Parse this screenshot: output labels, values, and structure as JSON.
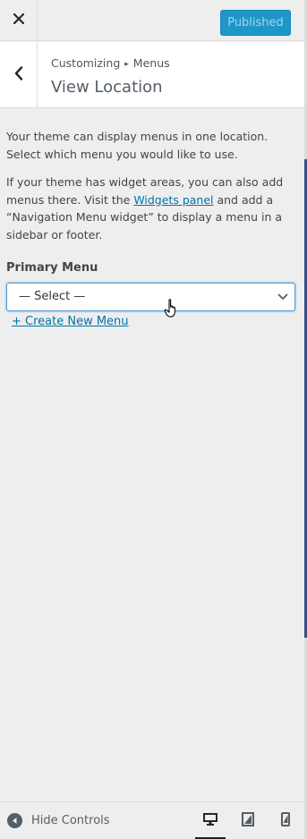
{
  "header": {
    "close_icon": "close-icon",
    "publish_label": "Published",
    "colors": {
      "publish_bg": "#1e96c8",
      "publish_text": "#a6d4ec"
    }
  },
  "section": {
    "breadcrumb_parent": "Customizing",
    "breadcrumb_separator": "▸",
    "breadcrumb_current": "Menus",
    "title": "View Location"
  },
  "content": {
    "desc1": "Your theme can display menus in one location. Select which menu you would like to use.",
    "desc2_before": "If your theme has widget areas, you can also add menus there. Visit the ",
    "desc2_link": "Widgets panel",
    "desc2_after": " and add a “Navigation Menu widget” to display a menu in a sidebar or footer.",
    "primary_menu_label": "Primary Menu",
    "select_value": "— Select —",
    "create_link": "+ Create New Menu"
  },
  "footer": {
    "hide_controls_label": "Hide Controls",
    "devices": [
      "desktop-icon",
      "tablet-icon",
      "mobile-icon"
    ],
    "active_device": "desktop"
  }
}
